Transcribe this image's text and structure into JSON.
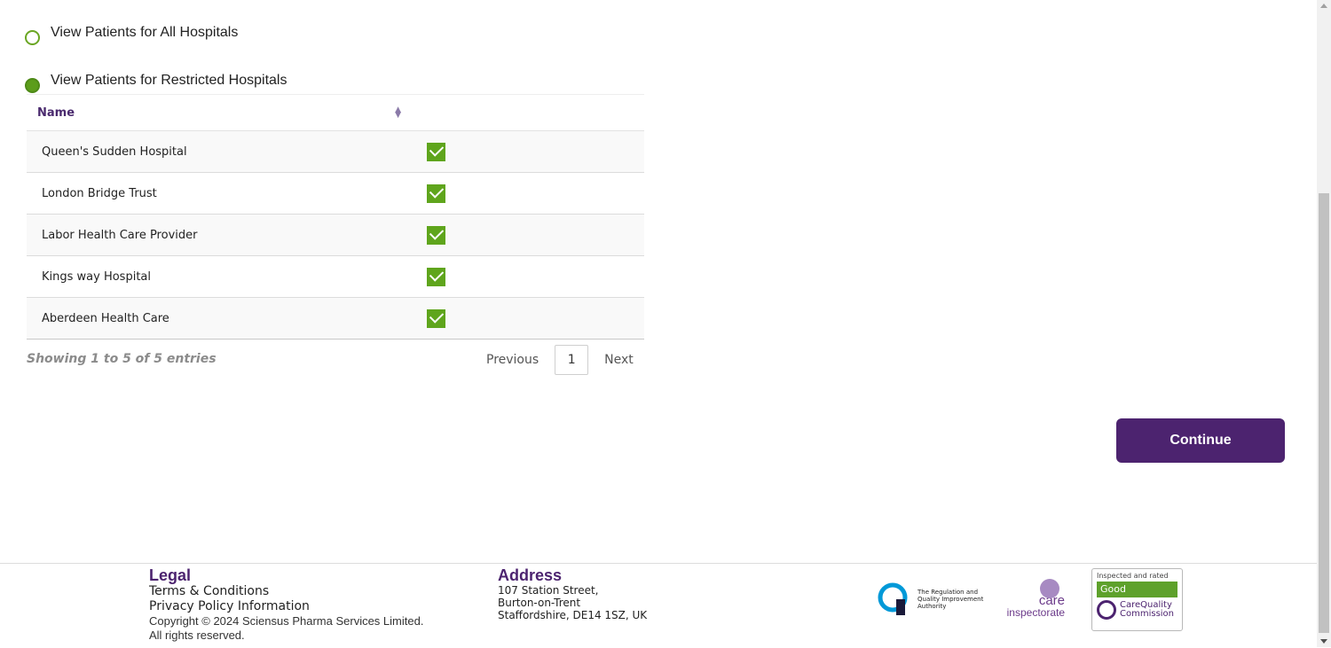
{
  "access_options": {
    "all_label": "View Patients for All Hospitals",
    "restricted_label": "View Patients for Restricted Hospitals",
    "selected": "restricted"
  },
  "table": {
    "columns": [
      "Name",
      ""
    ],
    "rows": [
      {
        "name": "Queen's Sudden Hospital",
        "checked": true
      },
      {
        "name": "London Bridge Trust",
        "checked": true
      },
      {
        "name": "Labor Health Care Provider",
        "checked": true
      },
      {
        "name": "Kings way Hospital",
        "checked": true
      },
      {
        "name": "Aberdeen Health Care",
        "checked": true
      }
    ],
    "info": "Showing 1 to 5 of 5 entries",
    "pager": {
      "previous": "Previous",
      "page": "1",
      "next": "Next"
    }
  },
  "continue_label": "Continue",
  "footer": {
    "legal_heading": "Legal",
    "terms": "Terms & Conditions",
    "privacy": "Privacy Policy Information",
    "copyright": "Copyright © 2024 Sciensus Pharma Services Limited.",
    "rights": "All rights reserved.",
    "address_heading": "Address",
    "address_lines": [
      "107 Station Street,",
      "Burton-on-Trent",
      "Staffordshire, DE14 1SZ, UK"
    ],
    "rqia_text": [
      "The Regulation and",
      "Quality Improvement",
      "Authority"
    ],
    "care_word": "care",
    "care_sub": "inspectorate",
    "cqc_top": "Inspected and rated",
    "cqc_rating": "Good",
    "cqc_name": [
      "CareQuality",
      "Commission"
    ]
  },
  "colors": {
    "brand_purple": "#4c236f",
    "check_green": "#5fa51c"
  }
}
